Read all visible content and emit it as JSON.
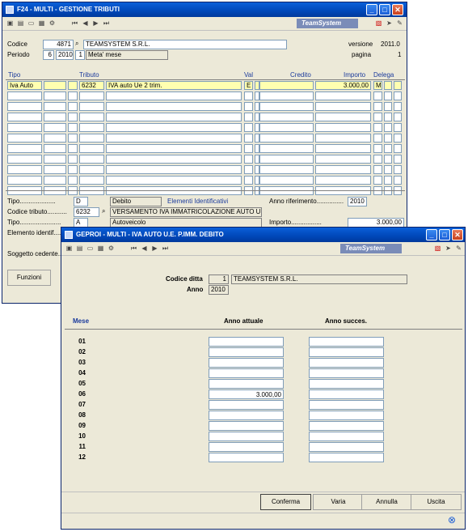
{
  "win1": {
    "title": "F24 - MULTI - GESTIONE TRIBUTI",
    "brand": "TeamSystem",
    "codice_label": "Codice",
    "codice_value": "4871",
    "codice_name": "TEAMSYSTEM S.R.L.",
    "periodo_label": "Periodo",
    "periodo_month": "6",
    "periodo_year": "2010",
    "periodo_num": "1",
    "periodo_desc": "Meta' mese",
    "versione_label": "versione",
    "versione_value": "2011.0",
    "pagina_label": "pagina",
    "pagina_value": "1",
    "headers": {
      "tipo": "Tipo",
      "tributo": "Tributo",
      "val": "Val",
      "credito": "Credito",
      "importo": "Importo",
      "delega": "Delega"
    },
    "row1": {
      "tipo": "Iva Auto",
      "codice": "6232",
      "descr": "IVA auto Ue 2 trim.",
      "val": "E",
      "importo": "3.000,00",
      "delega": "M"
    },
    "bottom": {
      "tipo_label": "Tipo....................",
      "tipo_value": "D",
      "tipo_desc": "Debito",
      "elementi_label": "Elementi Identificativi",
      "anno_rif_label": "Anno riferimento...............",
      "anno_rif_value": "2010",
      "codice_tributo_label": "Codice tributo...........",
      "codice_tributo_value": "6232",
      "codice_tributo_desc": "VERSAMENTO IVA IMMATRICOLAZIONE AUTO  UE -",
      "tipo2_label": "Tipo.......................",
      "tipo2_value": "A",
      "tipo2_desc": "Autoveicolo",
      "importo_label": "Importo.................",
      "importo_value": "3.000,00",
      "elemento_label": "Elemento identif.....",
      "soggetto_label": "Soggetto cedente....",
      "funzioni_label": "Funzioni"
    }
  },
  "win2": {
    "title": "GEPROI - MULTI - IVA AUTO U.E. P.IMM. DEBITO",
    "brand": "TeamSystem",
    "codice_ditta_label": "Codice ditta",
    "codice_ditta_value": "1",
    "codice_ditta_name": "TEAMSYSTEM S.R.L.",
    "anno_label": "Anno",
    "anno_value": "2010",
    "mese_header": "Mese",
    "anno_attuale_header": "Anno attuale",
    "anno_succ_header": "Anno succes.",
    "months": [
      "01",
      "02",
      "03",
      "04",
      "05",
      "06",
      "07",
      "08",
      "09",
      "10",
      "11",
      "12"
    ],
    "attuale_values": [
      "",
      "",
      "",
      "",
      "",
      "3.000,00",
      "",
      "",
      "",
      "",
      "",
      ""
    ],
    "succ_values": [
      "",
      "",
      "",
      "",
      "",
      "",
      "",
      "",
      "",
      "",
      "",
      ""
    ],
    "buttons": {
      "conferma": "Conferma",
      "varia": "Varia",
      "annulla": "Annulla",
      "uscita": "Uscita"
    }
  }
}
